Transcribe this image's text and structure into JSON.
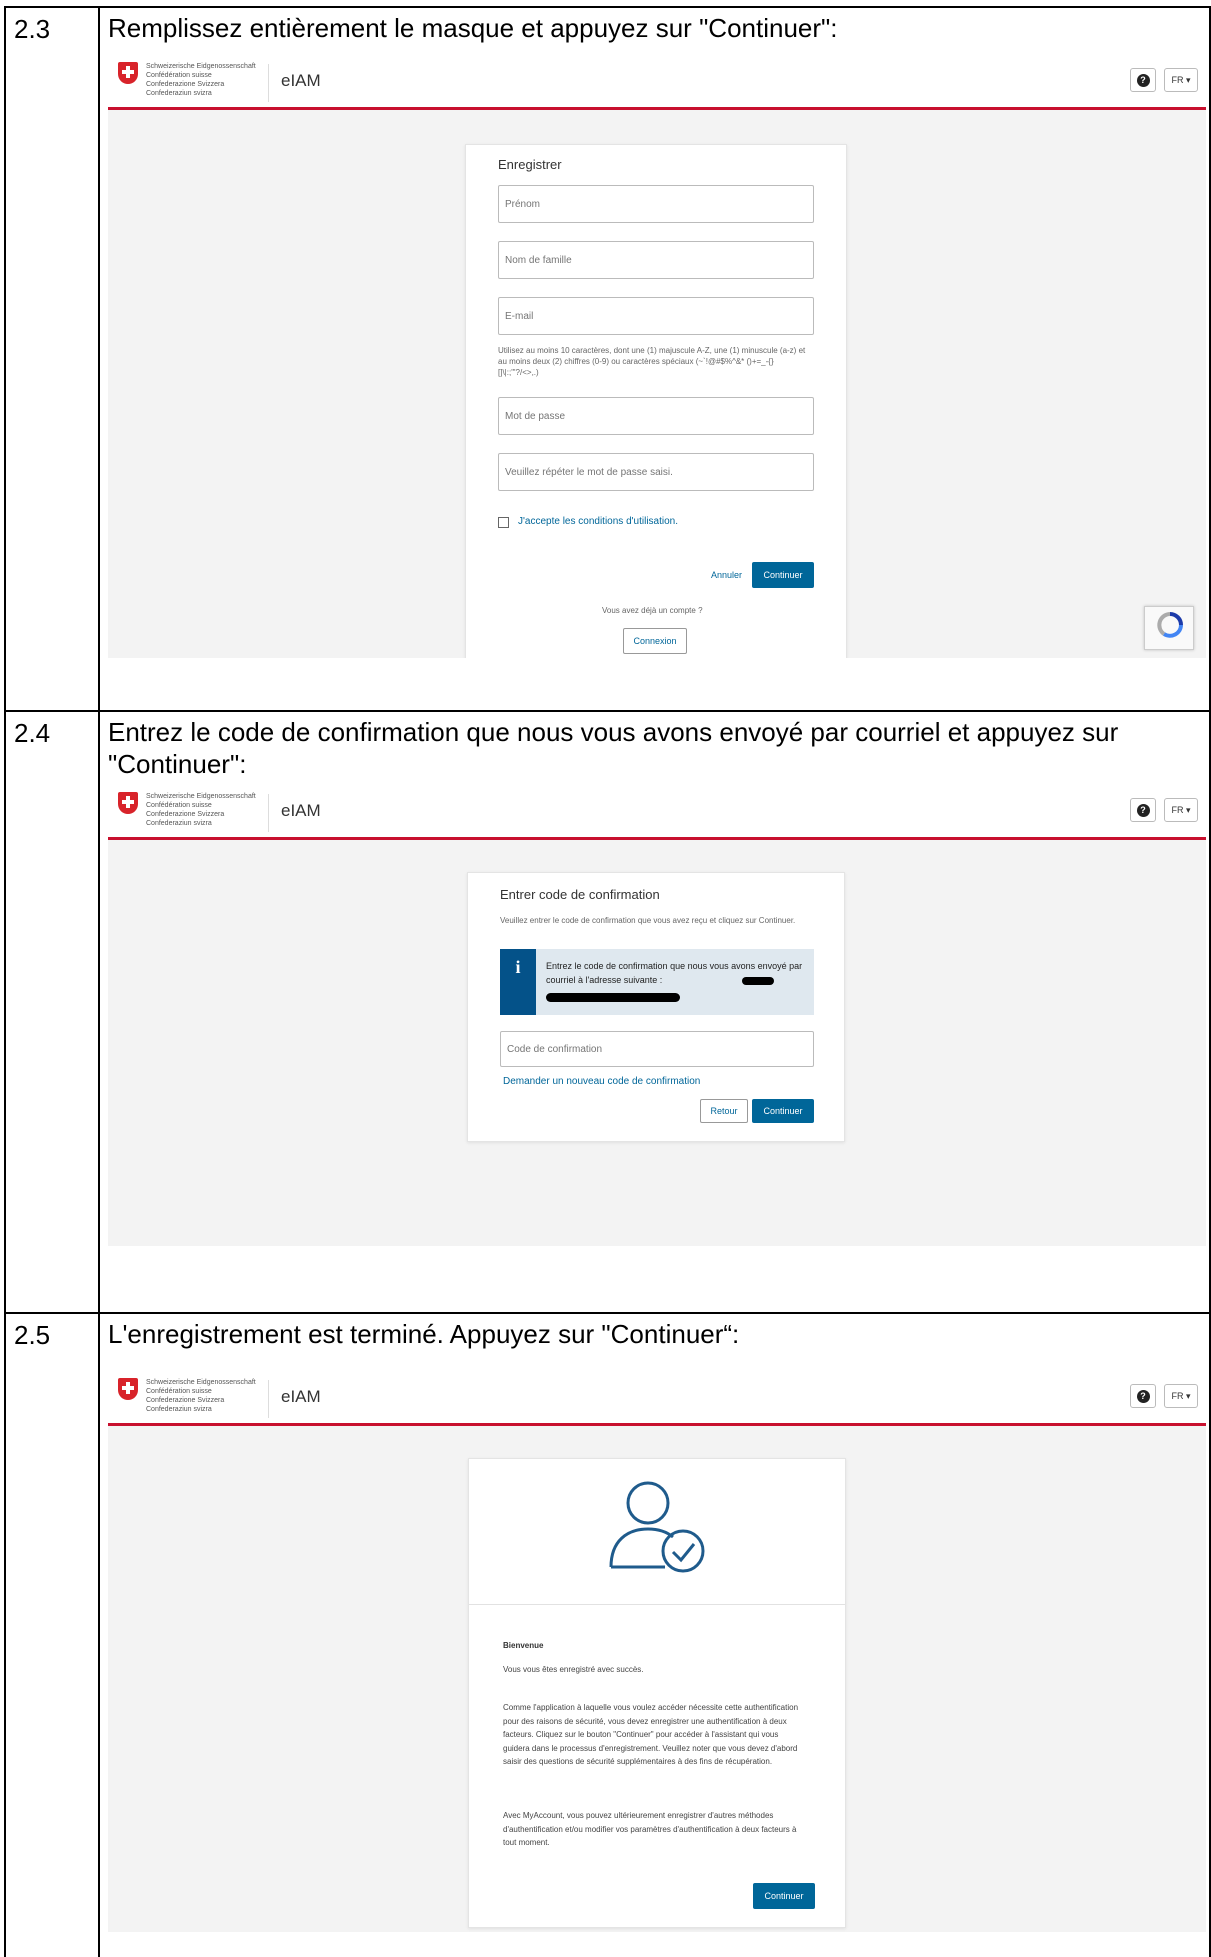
{
  "steps": [
    {
      "number": "2.3",
      "instruction": "Remplissez entièrement le masque et appuyez sur \"Continuer\":"
    },
    {
      "number": "2.4",
      "instruction": "Entrez le code de confirmation que nous vous avons envoyé par courriel et appuyez sur \"Continuer\":"
    },
    {
      "number": "2.5",
      "instruction": "L'enregistrement est terminé. Appuyez sur \"Continuer“:"
    }
  ],
  "header": {
    "confederation_lines": [
      "Schweizerische Eidgenossenschaft",
      "Confédération suisse",
      "Confederazione Svizzera",
      "Confederaziun svizra"
    ],
    "app_title": "eIAM",
    "help_label": "?",
    "language": "FR ▾"
  },
  "register": {
    "title": "Enregistrer",
    "firstname_placeholder": "Prénom",
    "lastname_placeholder": "Nom de famille",
    "email_placeholder": "E-mail",
    "password_hint": "Utilisez au moins 10 caractères, dont une (1) majuscule A-Z, une (1) minuscule (a-z) et au moins deux (2) chiffres (0-9) ou caractères spéciaux (~`!@#$%^&* ()+=_-{}[]\\|:;\"'?/<>,.)",
    "password_placeholder": "Mot de passe",
    "repeat_placeholder": "Veuillez répéter le mot de passe saisi.",
    "terms_label": "J'accepte les conditions d'utilisation.",
    "cancel_label": "Annuler",
    "continue_label": "Continuer",
    "have_account": "Vous avez déjà un compte ?",
    "login_label": "Connexion"
  },
  "confirm": {
    "title": "Entrer code de confirmation",
    "description": "Veuillez entrer le code de confirmation que vous avez reçu et cliquez sur Continuer.",
    "info_text": "Entrez le code de confirmation que nous vous avons envoyé par courriel à l'adresse suivante :",
    "code_placeholder": "Code de confirmation",
    "resend_link": "Demander un nouveau code de confirmation",
    "back_label": "Retour",
    "continue_label": "Continuer"
  },
  "welcome": {
    "title": "Bienvenue",
    "success": "Vous vous êtes enregistré avec succès.",
    "para1": "Comme l'application à laquelle vous voulez accéder nécessite cette authentification pour des raisons de sécurité, vous devez enregistrer une authentification à deux facteurs. Cliquez sur le bouton \"Continuer\" pour accéder à l'assistant qui vous guidera dans le processus d'enregistrement. Veuillez noter que vous devez d'abord saisir des questions de sécurité supplémentaires à des fins de récupération.",
    "para2": "Avec MyAccount, vous pouvez ultérieurement enregistrer d'autres méthodes d'authentification et/ou modifier vos paramètres d'authentification à deux facteurs à tout moment.",
    "continue_label": "Continuer"
  },
  "colors": {
    "accent_blue": "#006699",
    "swiss_red": "#c8102e"
  }
}
